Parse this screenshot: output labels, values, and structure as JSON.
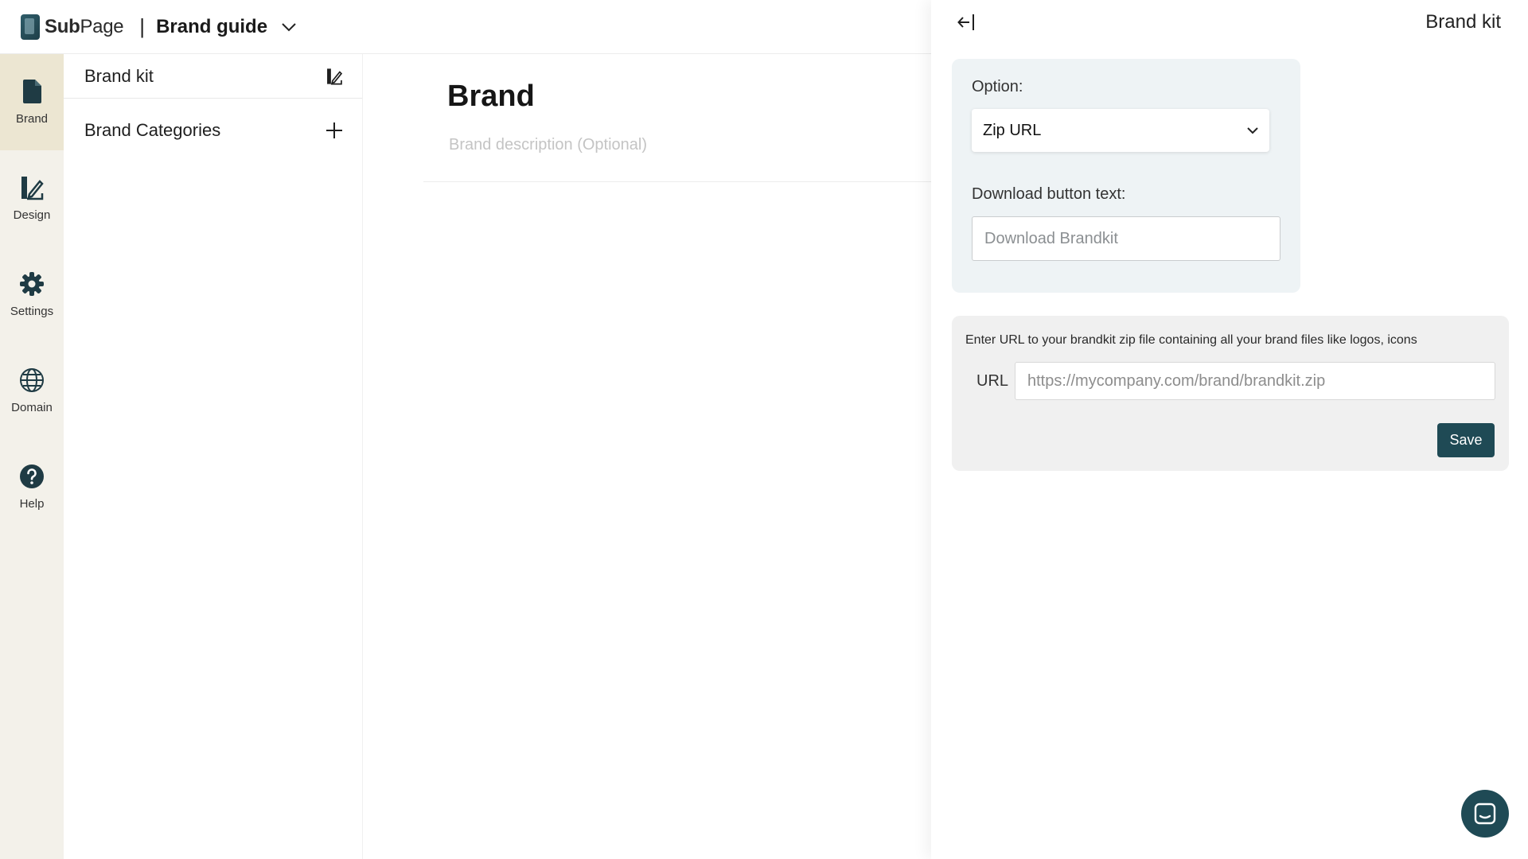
{
  "header": {
    "logo_bold": "Sub",
    "logo_light": "Page",
    "separator": "|",
    "doc_title": "Brand guide"
  },
  "rail": {
    "items": [
      {
        "label": "Brand",
        "icon": "document-icon",
        "active": true
      },
      {
        "label": "Design",
        "icon": "design-icon"
      },
      {
        "label": "Settings",
        "icon": "gear-icon"
      },
      {
        "label": "Domain",
        "icon": "globe-icon"
      },
      {
        "label": "Help",
        "icon": "help-icon"
      }
    ]
  },
  "sidebar": {
    "brand_kit": "Brand kit",
    "categories": "Brand Categories"
  },
  "main": {
    "title": "Brand",
    "description_placeholder": "Brand description (Optional)"
  },
  "panel": {
    "title": "Brand kit",
    "option_label": "Option:",
    "option_value": "Zip URL",
    "download_label": "Download button text:",
    "download_placeholder": "Download Brandkit",
    "url_hint": "Enter URL to your brandkit zip file containing all your brand files like logos, icons",
    "url_label": "URL",
    "url_placeholder": "https://mycompany.com/brand/brandkit.zip",
    "save_label": "Save"
  },
  "colors": {
    "accent": "#1f4a55",
    "rail_bg": "#f3f1ea",
    "rail_active": "#ece6d2",
    "option_card_bg": "#eef3f5",
    "url_card_bg": "#f0f0f0"
  }
}
